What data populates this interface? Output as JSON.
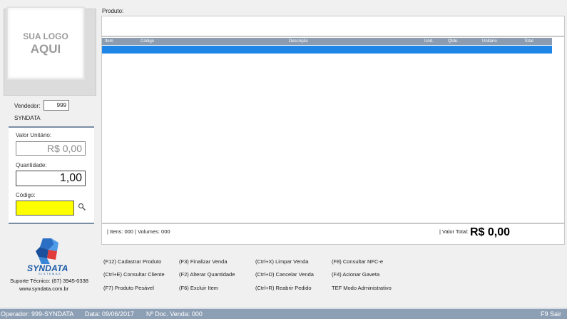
{
  "logo": {
    "line1": "SUA LOGO",
    "line2": "AQUI"
  },
  "vendedor": {
    "label": "Vendedor:",
    "value": "999",
    "name": "SYNDATA"
  },
  "valor_unitario": {
    "label": "Valor Unitário:",
    "value": "R$ 0,00"
  },
  "quantidade": {
    "label": "Quantidade:",
    "value": "1,00"
  },
  "codigo": {
    "label": "Código:",
    "value": ""
  },
  "brand": {
    "name": "SYNDATA",
    "tagline": "SISTEMAS",
    "support": "Suporte Técnico: (67) 3945-0338",
    "site": "www.syndata.com.br"
  },
  "produto": {
    "label": "Produto:"
  },
  "grid": {
    "columns": [
      "Item",
      "Código",
      "Descrição",
      "Und.",
      "Qtde.",
      "Unitário",
      "Total"
    ]
  },
  "footer": {
    "itens": "| Itens: 000 | Volumes: 000",
    "valor_total_label": "| Valor Total:",
    "valor_total": "R$ 0,00"
  },
  "shortcuts": [
    "(F12) Cadastrar Produto",
    "(F3) Finalizar Venda",
    "(Ctrl+X) Limpar Venda",
    "(F8) Consultar NFC-e",
    "(Ctrl+E) Consultar Cliente",
    "(F2) Alterar Quantidade",
    "(Ctrl+D) Cancelar Venda",
    "(F4) Acionar Gaveta",
    "(F7) Produto Pesável",
    "(F6) Excluir Item",
    "(Ctrl+R) Reabrir Pedido",
    "TEF Modo Administrativo"
  ],
  "status": {
    "operador": "Operador: 999-SYNDATA",
    "data": "Data: 09/06/2017",
    "doc": "Nº Doc. Venda: 000",
    "sair": "F9 Sair"
  },
  "colors": {
    "accent": "#1f86e8",
    "status_bar": "#8d9fb4",
    "code_field": "#ffff00",
    "brand": "#1a5aa6"
  }
}
